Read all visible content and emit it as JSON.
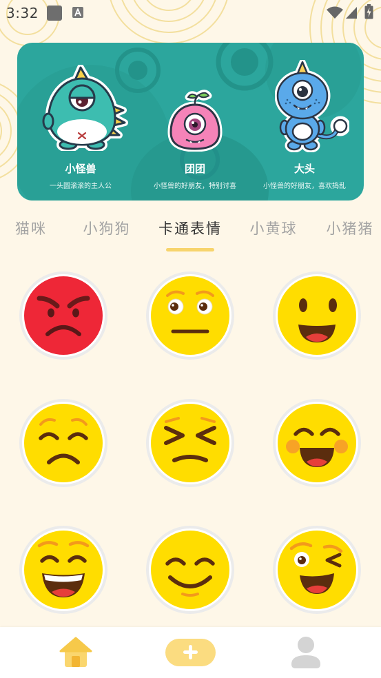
{
  "status_bar": {
    "time": "3:32",
    "left_icons": [
      "app-notification-icon",
      "keyboard-a-icon"
    ],
    "right_icons": [
      "wifi-icon",
      "signal-icon",
      "battery-charging-icon"
    ]
  },
  "banner": {
    "characters": [
      {
        "name": "小怪兽",
        "desc": "一头圆滚滚的主人公",
        "icon": "teal-monster-illustration"
      },
      {
        "name": "团团",
        "desc": "小怪兽的好朋友，特别讨喜",
        "icon": "pink-blob-monster-illustration"
      },
      {
        "name": "大头",
        "desc": "小怪兽的好朋友，喜欢捣乱",
        "icon": "blue-monster-illustration"
      }
    ]
  },
  "tabs": {
    "items": [
      {
        "label": "猫咪"
      },
      {
        "label": "小狗狗"
      },
      {
        "label": "卡通表情"
      },
      {
        "label": "小黄球"
      },
      {
        "label": "小猪猪"
      }
    ],
    "selected_index": 2
  },
  "stickers": [
    {
      "icon": "angry-face-icon",
      "color": "#ee2737"
    },
    {
      "icon": "neutral-face-icon",
      "color": "#ffdd00"
    },
    {
      "icon": "happy-face-icon",
      "color": "#ffdd00"
    },
    {
      "icon": "sad-face-icon",
      "color": "#ffdd00"
    },
    {
      "icon": "squinting-face-icon",
      "color": "#ffdd00"
    },
    {
      "icon": "laughing-blush-face-icon",
      "color": "#ffdd00"
    },
    {
      "icon": "grinning-face-icon",
      "color": "#ffdd00"
    },
    {
      "icon": "smiling-face-icon",
      "color": "#ffdd00"
    },
    {
      "icon": "winking-face-icon",
      "color": "#ffdd00"
    }
  ],
  "bottom_nav": {
    "items": [
      {
        "icon": "home-icon",
        "active": true
      },
      {
        "icon": "add-icon",
        "active": false
      },
      {
        "icon": "profile-icon",
        "active": false
      }
    ]
  },
  "colors": {
    "background": "#fef7e8",
    "banner": "#2ca69d",
    "accent": "#f7d46c",
    "tab_active": "#333333",
    "tab_inactive": "#a3a3a3",
    "nav_inactive": "#d4d4d4"
  }
}
